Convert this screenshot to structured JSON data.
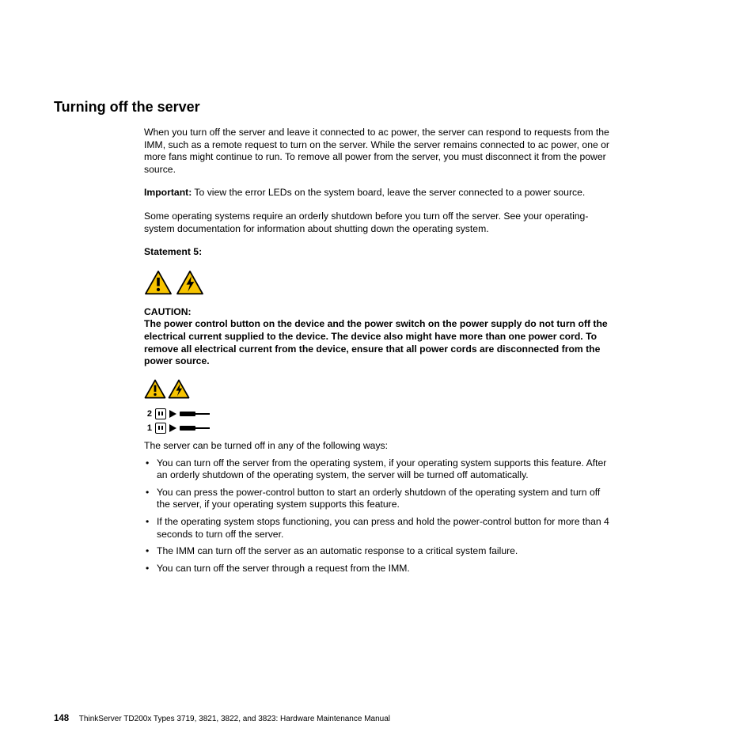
{
  "heading": "Turning off the server",
  "para1": "When you turn off the server and leave it connected to ac power, the server can respond to requests from the IMM, such as a remote request to turn on the server. While the server remains connected to ac power, one or more fans might continue to run. To remove all power from the server, you must disconnect it from the power source.",
  "important_label": "Important:",
  "important_text": "   To view the error LEDs on the system board, leave the server connected to a power source.",
  "para2": "Some operating systems require an orderly shutdown before you turn off the server. See your operating-system documentation for information about shutting down the operating system.",
  "statement_label": "Statement 5:",
  "caution_label": "CAUTION:",
  "caution_text": "The power control button on the device and the power switch on the power supply do not turn off the electrical current supplied to the device. The device also might have more than one power cord. To remove all electrical current from the device, ensure that all power cords are disconnected from the power source.",
  "diagram_2": "2",
  "diagram_1": "1",
  "ways_intro": "The server can be turned off in any of the following ways:",
  "bullets": [
    "You can turn off the server from the operating system, if your operating system supports this feature. After an orderly shutdown of the operating system, the server will be turned off automatically.",
    "You can press the power-control button to start an orderly shutdown of the operating system and turn off the server, if your operating system supports this feature.",
    "If the operating system stops functioning, you can press and hold the power-control button for more than 4 seconds to turn off the server.",
    "The IMM can turn off the server as an automatic response to a critical system failure.",
    "You can turn off the server through a request from the IMM."
  ],
  "footer_page": "148",
  "footer_text": "ThinkServer TD200x Types 3719, 3821, 3822, and 3823:  Hardware Maintenance Manual"
}
